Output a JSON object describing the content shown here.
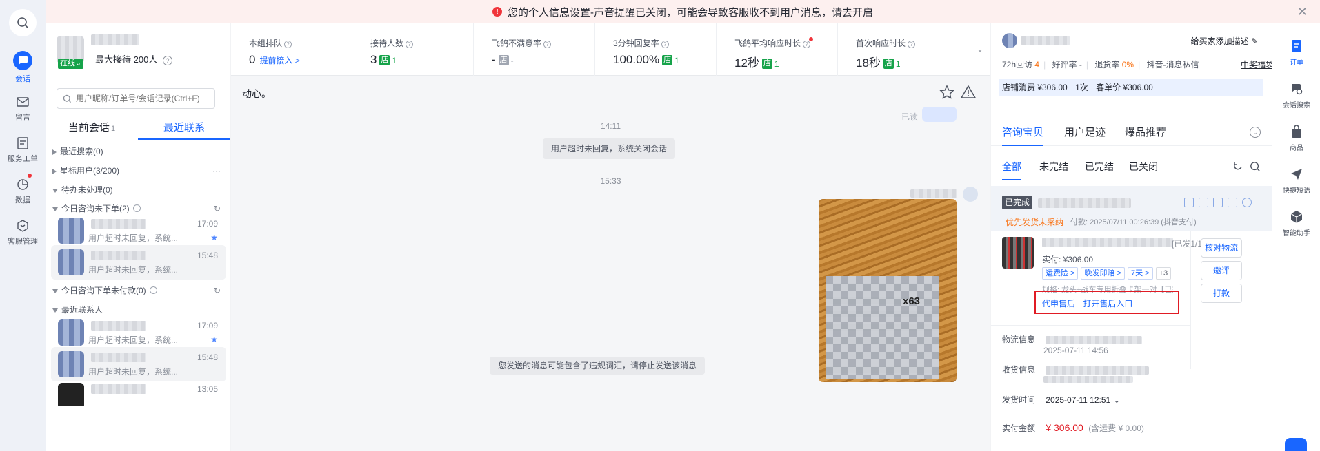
{
  "banner": {
    "text": "您的个人信息设置-声音提醒已关闭，可能会导致客服收不到用户消息，请去开启",
    "warn_glyph": "!",
    "close_glyph": "✕"
  },
  "left_rail": {
    "items": [
      {
        "label": "会话",
        "icon": "chat-icon",
        "active": true
      },
      {
        "label": "留言",
        "icon": "mail-icon"
      },
      {
        "label": "服务工单",
        "icon": "ticket-icon"
      },
      {
        "label": "数据",
        "icon": "chart-icon",
        "dot": true
      },
      {
        "label": "客服管理",
        "icon": "service-manage-icon"
      }
    ]
  },
  "session_list": {
    "status": "在线",
    "reception_prefix": "最大接待",
    "reception_count": "200人",
    "search_placeholder": "用户昵称/订单号/会话记录(Ctrl+F)",
    "tabs": [
      {
        "label": "当前会话"
      },
      {
        "label": "最近联系",
        "active": true
      }
    ],
    "tab_badge": "1",
    "groups": [
      {
        "label": "最近搜索(0)",
        "expanded": false
      },
      {
        "label": "星标用户(3/200)",
        "expanded": false,
        "more": "···"
      },
      {
        "label": "待办未处理(0)",
        "expanded": true
      },
      {
        "label": "今日咨询未下单(2)",
        "expanded": true
      },
      {
        "label": "今日咨询下单未付款(0)",
        "expanded": true
      },
      {
        "label": "最近联系人",
        "expanded": true
      }
    ],
    "sessions": [
      {
        "time": "17:09",
        "msg": "用户超时未回复，系统...",
        "star": true
      },
      {
        "time": "15:48",
        "msg": "用户超时未回复，系统...",
        "selected": true
      },
      {
        "time": "17:09",
        "msg": "用户超时未回复，系统...",
        "star": true
      },
      {
        "time": "15:48",
        "msg": "用户超时未回复，系统...",
        "selected": true
      },
      {
        "time": "13:05",
        "msg": ""
      }
    ]
  },
  "metrics": [
    {
      "label": "本组排队",
      "value": "0",
      "link": "提前接入 >"
    },
    {
      "label": "接待人数",
      "value": "3",
      "store": "店",
      "store_val": "1"
    },
    {
      "label": "飞鸽不满意率",
      "value": "-",
      "store": "店",
      "store_val": "-",
      "grey": true
    },
    {
      "label": "3分钟回复率",
      "value": "100.00%",
      "store": "店",
      "store_val": "1"
    },
    {
      "label": "飞鸽平均响应时长",
      "value": "12秒",
      "store": "店",
      "store_val": "1",
      "dot": true
    },
    {
      "label": "首次响应时长",
      "value": "18秒",
      "store": "店",
      "store_val": "1"
    }
  ],
  "chat": {
    "top_text": "动心。",
    "read_label": "已读",
    "time1": "14:11",
    "system_msg": "用户超时未回复，系统关闭会话",
    "time2": "15:33",
    "photo_text": "x63",
    "warning_msg": "您发送的消息可能包含了违规词汇，请停止发送该消息"
  },
  "right_panel": {
    "add_desc": "给买家添加描述",
    "stats": {
      "return_label": "72h回访",
      "return_val": "4",
      "good_label": "好评率",
      "good_val": "-",
      "refund_label": "退货率",
      "refund_val": "0%",
      "source": "抖音-消息私信",
      "link": "中奖福袋"
    },
    "spend": {
      "consume": "店铺消费 ¥306.00",
      "times": "1次",
      "avg": "客单价 ¥306.00"
    },
    "main_tabs": [
      "咨询宝贝",
      "用户足迹",
      "爆品推荐"
    ],
    "sub_tabs": [
      "全部",
      "未完结",
      "已完结",
      "已关闭"
    ],
    "order": {
      "status": "已完成",
      "priority": "优先发货未采纳",
      "pay_time": "付款: 2025/07/11 00:26:39 (抖音支付)",
      "ship_state": "[已发1/1]",
      "paid": "实付: ¥306.00",
      "tags": [
        "运费险 >",
        "晚发即赔 >",
        "7天 >",
        "+3"
      ],
      "spec": "规格: 龙头+战车专用折叠卡架一对【已升级...",
      "links": [
        "代申售后",
        "打开售后入口"
      ],
      "side_buttons": [
        "核对物流",
        "邀评",
        "打款"
      ],
      "logistics_label": "物流信息",
      "logistics_time": "2025-07-11 14:56",
      "receiver_label": "收货信息",
      "ship_time_label": "发货时间",
      "ship_time": "2025-07-11 12:51",
      "amount_label": "实付金额",
      "amount": "¥ 306.00",
      "amount_note": "(含运费 ¥ 0.00)"
    }
  },
  "right_rail": [
    {
      "label": "订单",
      "icon": "order-icon",
      "active": true
    },
    {
      "label": "会话搜索",
      "icon": "session-search-icon"
    },
    {
      "label": "商品",
      "icon": "goods-icon"
    },
    {
      "label": "快捷短语",
      "icon": "send-icon"
    },
    {
      "label": "智能助手",
      "icon": "cube-icon"
    }
  ]
}
